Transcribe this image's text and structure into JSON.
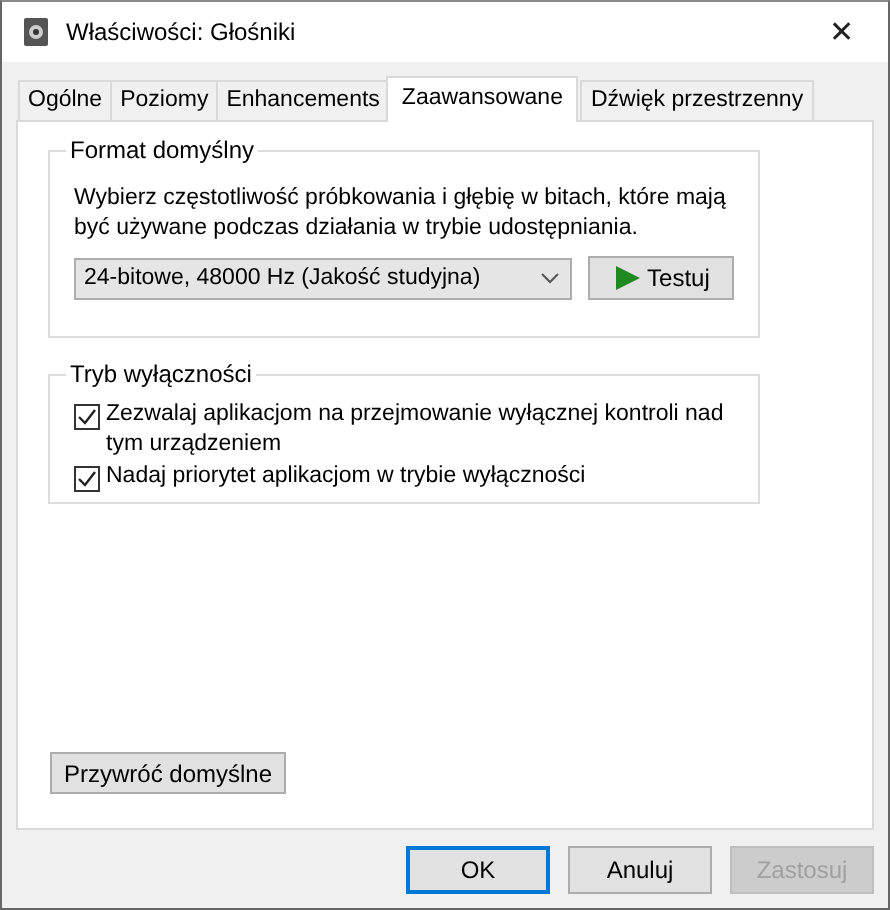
{
  "window": {
    "title": "Właściwości: Głośniki",
    "close": "✕"
  },
  "tabs": [
    {
      "label": "Ogólne",
      "selected": false
    },
    {
      "label": "Poziomy",
      "selected": false
    },
    {
      "label": "Enhancements",
      "selected": false
    },
    {
      "label": "Zaawansowane",
      "selected": true
    },
    {
      "label": "Dźwięk przestrzenny",
      "selected": false
    }
  ],
  "format_group": {
    "title": "Format domyślny",
    "description": "Wybierz częstotliwość próbkowania i głębię w bitach, które mają być używane podczas działania w trybie udostępniania.",
    "format_select": {
      "value": "24-bitowe, 48000 Hz (Jakość studyjna)"
    },
    "test_button": "Testuj"
  },
  "exclusive_group": {
    "title": "Tryb wyłączności",
    "options": [
      {
        "label": "Zezwalaj aplikacjom na przejmowanie wyłącznej kontroli nad tym urządzeniem",
        "checked": true
      },
      {
        "label": "Nadaj priorytet aplikacjom w trybie wyłączności",
        "checked": true
      }
    ]
  },
  "restore_button": "Przywróć domyślne",
  "buttons": [
    {
      "label": "OK",
      "default": true,
      "disabled": false
    },
    {
      "label": "Anuluj",
      "default": false,
      "disabled": false
    },
    {
      "label": "Zastosuj",
      "default": false,
      "disabled": true
    }
  ]
}
